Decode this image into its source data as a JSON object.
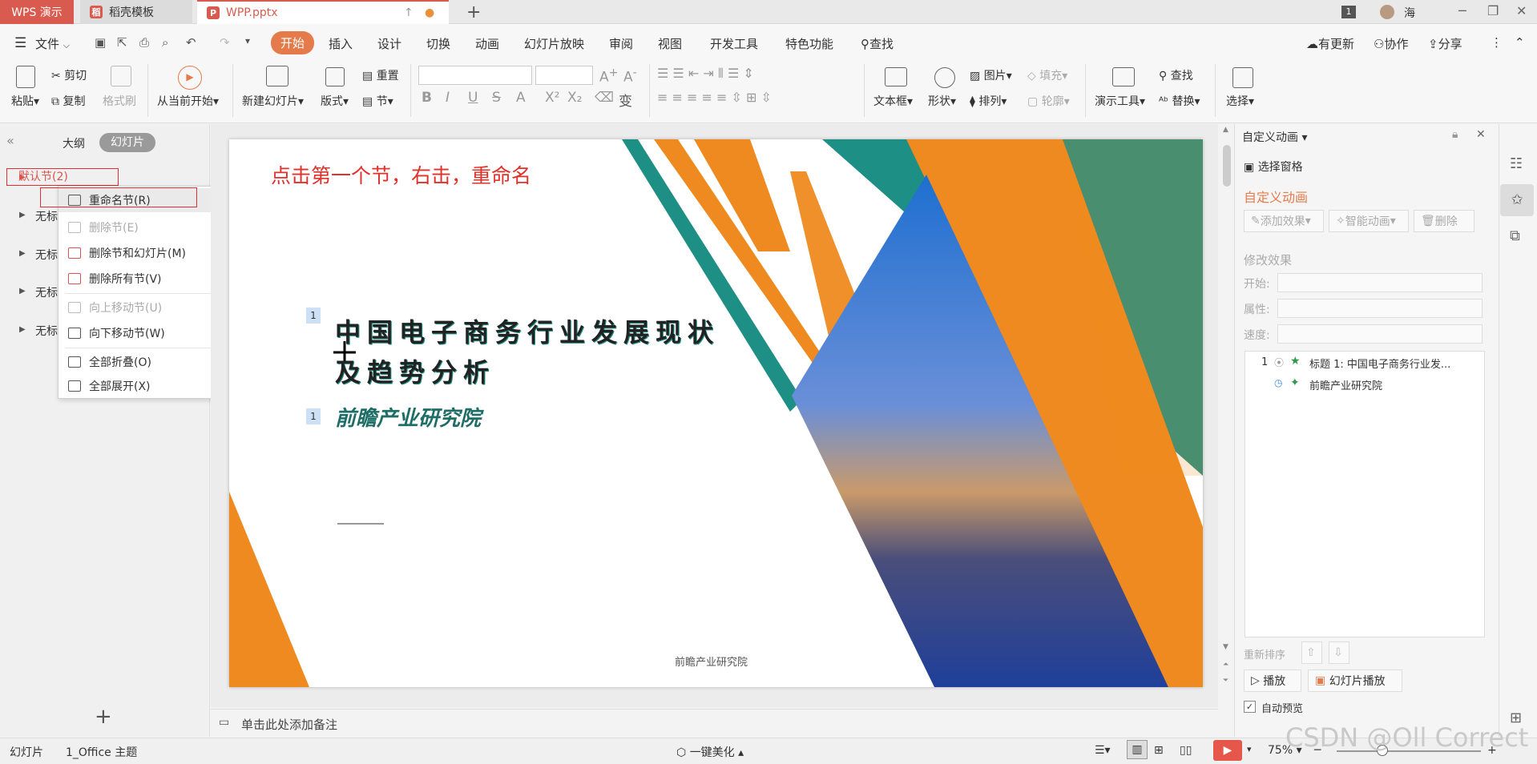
{
  "titlebar": {
    "app_tab": "WPS 演示",
    "template_tab": "稻壳模板",
    "file_tab": "WPP.pptx",
    "page_badge": "1",
    "user": "海"
  },
  "menu": {
    "file": "文件",
    "items": [
      "开始",
      "插入",
      "设计",
      "切换",
      "动画",
      "幻灯片放映",
      "审阅",
      "视图",
      "开发工具",
      "特色功能"
    ],
    "search": "查找",
    "update": "有更新",
    "collab": "协作",
    "share": "分享"
  },
  "ribbon": {
    "paste": "粘贴",
    "cut": "剪切",
    "copy": "复制",
    "format_painter": "格式刷",
    "from_current": "从当前开始",
    "new_slide": "新建幻灯片",
    "layout": "版式",
    "reset": "重置",
    "section": "节",
    "textbox": "文本框",
    "shape": "形状",
    "picture": "图片",
    "fill": "填充",
    "arrange": "排列",
    "outline": "轮廓",
    "present_tools": "演示工具",
    "find": "查找",
    "replace": "替换",
    "select": "选择"
  },
  "leftpanel": {
    "tab_outline": "大纲",
    "tab_slides": "幻灯片",
    "default_section": "默认节(2)",
    "untitled_sections": [
      "无标",
      "无标",
      "无标",
      "无标"
    ]
  },
  "context_menu": {
    "items": [
      {
        "label": "重命名节(R)",
        "disabled": false
      },
      {
        "label": "删除节(E)",
        "disabled": true
      },
      {
        "label": "删除节和幻灯片(M)",
        "disabled": false
      },
      {
        "label": "删除所有节(V)",
        "disabled": false
      },
      {
        "label": "向上移动节(U)",
        "disabled": true
      },
      {
        "label": "向下移动节(W)",
        "disabled": false
      },
      {
        "label": "全部折叠(O)",
        "disabled": false
      },
      {
        "label": "全部展开(X)",
        "disabled": false
      }
    ]
  },
  "slide": {
    "annotation": "点击第一个节，右击，重命名",
    "title": "中国电子商务行业发展现状\n及趋势分析",
    "subtitle": "前瞻产业研究院",
    "anim_tag": "1",
    "footer": "前瞻产业研究院",
    "colors": {
      "orange": "#ee8a1f",
      "teal": "#1e8f84",
      "red": "#e0312a"
    }
  },
  "notes": {
    "placeholder": "单击此处添加备注"
  },
  "rightpanel": {
    "header": "自定义动画",
    "selection_pane": "选择窗格",
    "section_title": "自定义动画",
    "add_effect": "添加效果",
    "smart_anim": "智能动画",
    "delete": "删除",
    "modify": "修改效果",
    "start_label": "开始:",
    "prop_label": "属性:",
    "speed_label": "速度:",
    "anim_items": [
      {
        "num": "1",
        "label": "标题 1: 中国电子商务行业发..."
      },
      {
        "num": "",
        "label": "前瞻产业研究院"
      }
    ],
    "reorder": "重新排序",
    "play": "播放",
    "slideshow": "幻灯片播放",
    "auto_preview": "自动预览"
  },
  "statusbar": {
    "slide": "幻灯片",
    "theme": "1_Office 主题",
    "beautify": "一键美化",
    "zoom": "75%"
  },
  "watermark": "CSDN @Oll Correct"
}
